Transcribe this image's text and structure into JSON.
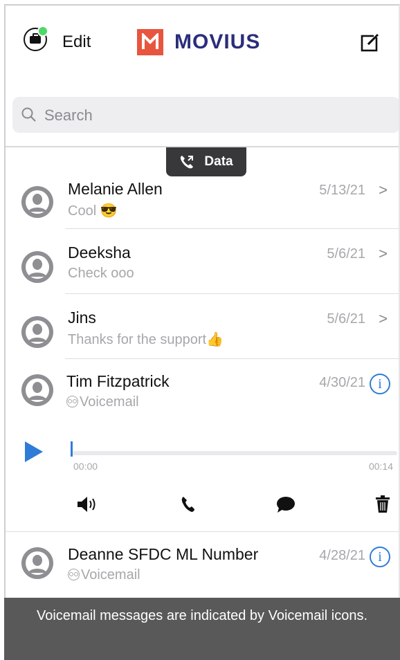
{
  "header": {
    "edit_label": "Edit",
    "brand": "MOVIUS",
    "brand_color": "#e8553f",
    "brand_text_color": "#2b2e7a",
    "status_dot_color": "#4cd964"
  },
  "search": {
    "placeholder": "Search"
  },
  "data_badge": {
    "label": "Data"
  },
  "conversations": [
    {
      "name": "Melanie Allen",
      "preview": "Cool 😎",
      "date": "5/13/21",
      "action": "chevron"
    },
    {
      "name": "Deeksha",
      "preview": "Check ooo",
      "date": "5/6/21",
      "action": "chevron"
    },
    {
      "name": "Jins",
      "preview": "Thanks for the support👍",
      "date": "5/6/21",
      "action": "chevron"
    },
    {
      "name": "Tim Fitzpatrick",
      "preview": "Voicemail",
      "date": "4/30/21",
      "action": "info",
      "voicemail": true
    },
    {
      "name": "Deanne SFDC ML Number",
      "preview": "Voicemail",
      "date": "4/28/21",
      "action": "info",
      "voicemail": true
    }
  ],
  "player": {
    "current_time": "00:00",
    "duration": "00:14",
    "progress": 0,
    "accent_color": "#2f7bd8",
    "actions": [
      "speaker-icon",
      "phone-icon",
      "chat-icon",
      "trash-icon"
    ]
  },
  "caption": "Voicemail messages are indicated by Voicemail icons."
}
